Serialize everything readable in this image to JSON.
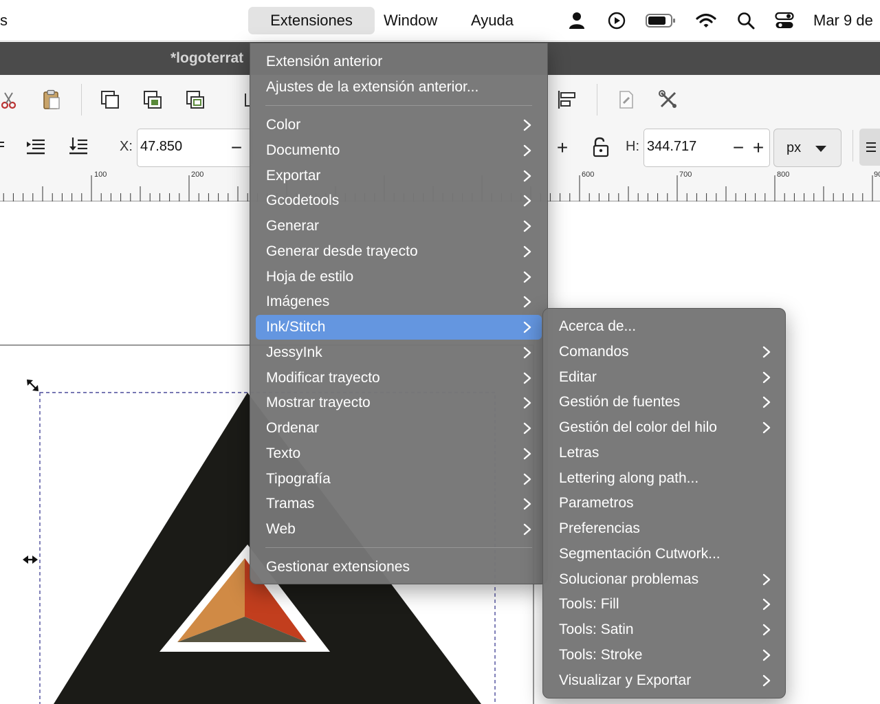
{
  "menubar": {
    "cut_text": "s",
    "items": [
      "Extensiones",
      "Window",
      "Ayuda"
    ],
    "date": "Mar 9 de"
  },
  "window": {
    "title": "*logoterrat"
  },
  "toolbar": {
    "x_label": "X:",
    "x_value": "47.850",
    "h_label": "H:",
    "h_value": "344.717",
    "unit": "px"
  },
  "ruler": {
    "labels": [
      "100",
      "200",
      "600",
      "700",
      "800",
      "90"
    ]
  },
  "main_menu": {
    "top_items": [
      "Extensión anterior",
      "Ajustes de la extensión anterior..."
    ],
    "items": [
      {
        "label": "Color"
      },
      {
        "label": "Documento"
      },
      {
        "label": "Exportar"
      },
      {
        "label": "Gcodetools"
      },
      {
        "label": "Generar"
      },
      {
        "label": "Generar desde trayecto"
      },
      {
        "label": "Hoja de estilo"
      },
      {
        "label": "Imágenes"
      },
      {
        "label": "Ink/Stitch"
      },
      {
        "label": "JessyInk"
      },
      {
        "label": "Modificar trayecto"
      },
      {
        "label": "Mostrar trayecto"
      },
      {
        "label": "Ordenar"
      },
      {
        "label": "Texto"
      },
      {
        "label": "Tipografía"
      },
      {
        "label": "Tramas"
      },
      {
        "label": "Web"
      }
    ],
    "highlighted": "Ink/Stitch",
    "bottom_item": "Gestionar extensiones"
  },
  "submenu": {
    "items": [
      {
        "label": "Acerca de...",
        "has_submenu": false
      },
      {
        "label": "Comandos",
        "has_submenu": true
      },
      {
        "label": "Editar",
        "has_submenu": true
      },
      {
        "label": "Gestión de fuentes",
        "has_submenu": true
      },
      {
        "label": "Gestión del color del hilo",
        "has_submenu": true
      },
      {
        "label": "Letras",
        "has_submenu": false
      },
      {
        "label": "Lettering along path...",
        "has_submenu": false
      },
      {
        "label": "Parametros",
        "has_submenu": false
      },
      {
        "label": "Preferencias",
        "has_submenu": false
      },
      {
        "label": "Segmentación Cutwork...",
        "has_submenu": false
      },
      {
        "label": "Solucionar problemas",
        "has_submenu": true
      },
      {
        "label": "Tools: Fill",
        "has_submenu": true
      },
      {
        "label": "Tools: Satin",
        "has_submenu": true
      },
      {
        "label": "Tools: Stroke",
        "has_submenu": true
      },
      {
        "label": "Visualizar y Exportar",
        "has_submenu": true
      }
    ]
  },
  "colors": {
    "menu_bg": "#767676",
    "highlight": "#6496e0",
    "titlebar": "#4b4b4b",
    "logo_dark": "#1b1b17",
    "logo_orange": "#d08a45",
    "logo_red": "#c23e1e",
    "logo_olive": "#575441",
    "selection_dash": "#4a4a9a"
  },
  "icons": [
    "user-icon",
    "play-icon",
    "battery-icon",
    "wifi-icon",
    "search-icon",
    "control-center-icon",
    "cut-icon",
    "paste-icon",
    "duplicate-icon",
    "clone-icon",
    "unlink-clone-icon",
    "align-icon",
    "xml-editor-icon",
    "preferences-icon",
    "lock-icon",
    "chevron-right-icon",
    "chevron-down-icon",
    "scale-arrow-icon"
  ]
}
